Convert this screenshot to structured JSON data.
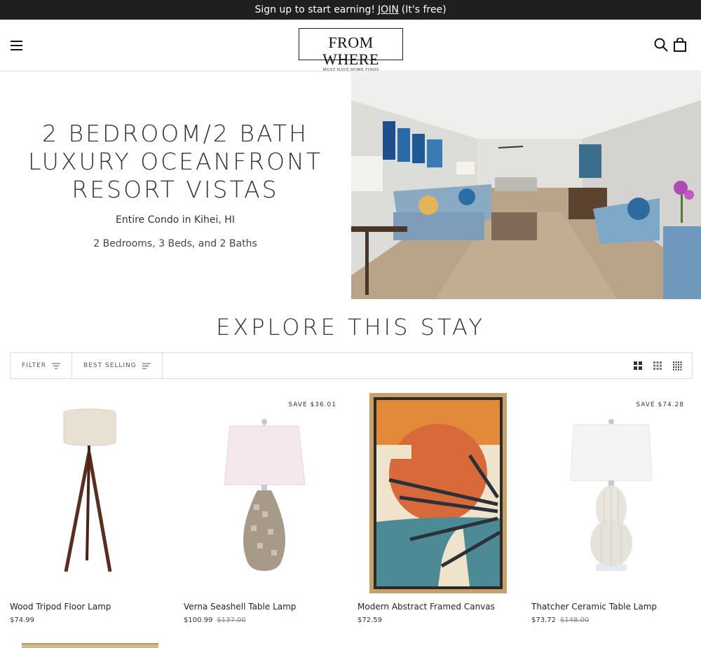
{
  "announcement": {
    "text": "Sign up to start earning!",
    "join": "JOIN",
    "suffix": "(It's free)"
  },
  "header": {
    "logo_main": "FROM WHERE",
    "logo_tagline": "MUST HAVE HOME FINDS",
    "icons": [
      "menu-icon",
      "search-icon",
      "cart-icon"
    ]
  },
  "hero": {
    "title": "2 BEDROOM/2 BATH LUXURY OCEANFRONT RESORT VISTAS",
    "subtitle": "Entire Condo in Kihei, HI",
    "meta": "2 Bedrooms, 3 Beds, and 2 Baths"
  },
  "section": {
    "title": "EXPLORE THIS STAY"
  },
  "toolbar": {
    "filter_label": "FILTER",
    "sort_label": "BEST SELLING",
    "grid_icons": [
      "grid-2-icon",
      "grid-3-icon",
      "grid-4-icon"
    ]
  },
  "products": [
    {
      "title": "Wood Tripod Floor Lamp",
      "price": "$74.99",
      "compare": "",
      "badge": ""
    },
    {
      "title": "Verna Seashell Table Lamp",
      "price": "$100.99",
      "compare": "$137.00",
      "badge": "SAVE $36.01"
    },
    {
      "title": "Modern Abstract Framed Canvas",
      "price": "$72.59",
      "compare": "",
      "badge": ""
    },
    {
      "title": "Thatcher Ceramic Table Lamp",
      "price": "$73.72",
      "compare": "$148.00",
      "badge": "SAVE $74.28"
    }
  ],
  "colors": {
    "announce_bg": "#1f1f1f",
    "accent_orange": "#d8693a",
    "accent_teal": "#4c8a95"
  }
}
